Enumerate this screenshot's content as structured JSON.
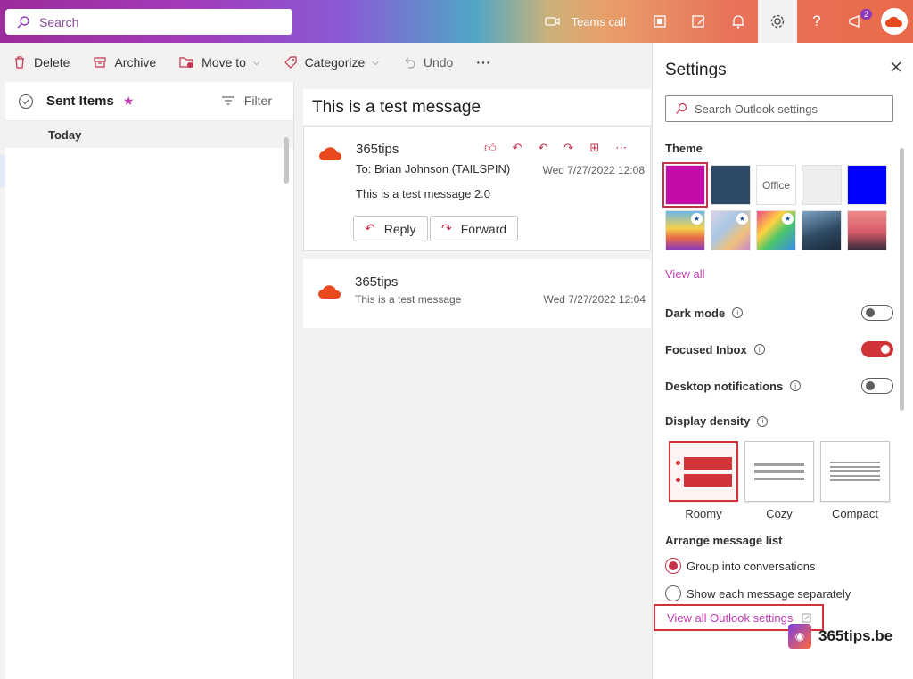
{
  "search": {
    "placeholder": "Search"
  },
  "topbar": {
    "teams_call": "Teams call",
    "notification_badge": "2"
  },
  "toolbar": {
    "delete": "Delete",
    "archive": "Archive",
    "move_to": "Move to",
    "categorize": "Categorize",
    "undo": "Undo",
    "more": "···"
  },
  "folder": {
    "title": "Sent Items",
    "filter": "Filter",
    "group": "Today"
  },
  "reading": {
    "subject": "This is a test message",
    "messages": [
      {
        "sender": "365tips",
        "to": "To:  Brian Johnson (TAILSPIN)",
        "date": "Wed 7/27/2022 12:08",
        "body": "This is a test message 2.0",
        "reply": "Reply",
        "forward": "Forward"
      },
      {
        "sender": "365tips",
        "preview": "This is a test message",
        "date": "Wed 7/27/2022 12:04"
      }
    ]
  },
  "settings": {
    "title": "Settings",
    "search_placeholder": "Search Outlook settings",
    "theme_label": "Theme",
    "office_swatch": "Office",
    "view_all": "View all",
    "dark_mode": "Dark mode",
    "focused_inbox": "Focused Inbox",
    "desktop_notifications": "Desktop notifications",
    "display_density": "Display density",
    "density": [
      "Roomy",
      "Cozy",
      "Compact"
    ],
    "arrange_label": "Arrange message list",
    "arrange_options": [
      "Group into conversations",
      "Show each message separately"
    ],
    "view_all_settings": "View all Outlook settings",
    "toggles": {
      "dark_mode": false,
      "focused_inbox": true,
      "desktop_notifications": false
    }
  },
  "brand": {
    "name": "365tips.be"
  },
  "colors": {
    "accent": "#c239b3",
    "toggle_on": "#d13438"
  }
}
